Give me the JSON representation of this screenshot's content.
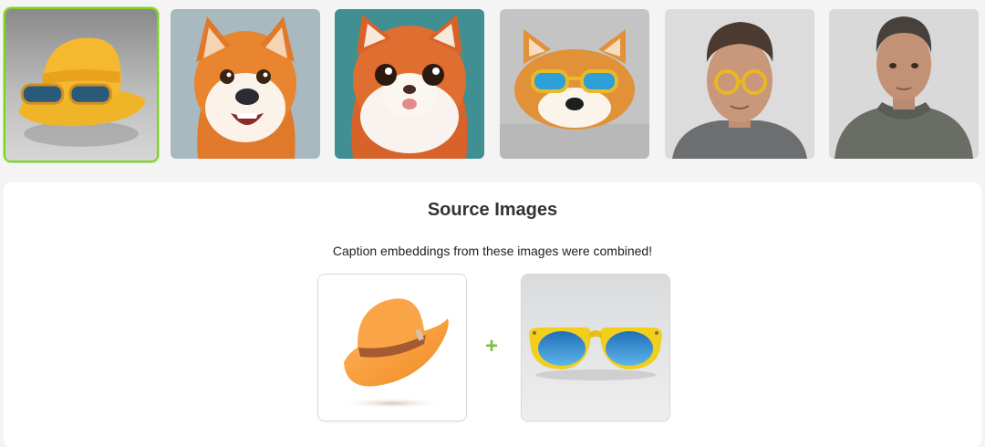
{
  "gallery": {
    "selected_index": 0,
    "items": [
      {
        "name": "hat-with-sunglasses-result"
      },
      {
        "name": "cartoon-shiba-dog-result"
      },
      {
        "name": "cartoon-fluffy-cat-result"
      },
      {
        "name": "shiba-with-glasses-result"
      },
      {
        "name": "man-with-yellow-glasses-result"
      },
      {
        "name": "man-portrait-result"
      }
    ]
  },
  "source_panel": {
    "title": "Source Images",
    "subtitle": "Caption embeddings from these images were combined!",
    "plus_symbol": "+",
    "sources": [
      {
        "name": "orange-fedora-hat"
      },
      {
        "name": "yellow-blue-sunglasses"
      }
    ]
  },
  "colors": {
    "selection_border": "#7ed321",
    "plus": "#7cc242",
    "title_text": "#333333"
  }
}
